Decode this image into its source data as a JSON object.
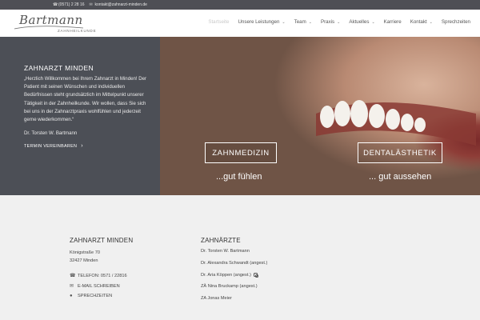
{
  "topbar": {
    "phone": "(0571) 2 28 16",
    "email": "kontakt@zahnarzt-minden.de",
    "phone_icon": "phone-icon",
    "email_icon": "envelope-icon"
  },
  "header": {
    "logo_script": "Bartmann",
    "logo_sub": "ZAHNHEILKUNDE",
    "nav": [
      {
        "label": "Startseite",
        "active": true,
        "dropdown": false
      },
      {
        "label": "Unsere Leistungen",
        "active": false,
        "dropdown": true
      },
      {
        "label": "Team",
        "active": false,
        "dropdown": true
      },
      {
        "label": "Praxis",
        "active": false,
        "dropdown": true
      },
      {
        "label": "Aktuelles",
        "active": false,
        "dropdown": true
      },
      {
        "label": "Karriere",
        "active": false,
        "dropdown": false
      },
      {
        "label": "Kontakt",
        "active": false,
        "dropdown": true
      },
      {
        "label": "Sprechzeiten",
        "active": false,
        "dropdown": false
      }
    ]
  },
  "hero": {
    "title": "ZAHNARZT MINDEN",
    "paragraph": "„Herzlich Willkommen bei Ihrem Zahnarzt in Minden! Der Patient mit seinen Wünschen und individuellen Bedürfnissen steht grundsätzlich im Mittelpunkt unserer Tätigkeit in der Zahnheilkunde. Wir wollen, dass Sie sich bei uns in der Zahnarztpraxis wohlfühlen und jederzeit gerne wiederkommen.“",
    "signature": "Dr. Torsten W. Bartmann",
    "cta": "TERMIN VEREINBAREN",
    "button_left": "ZAHNMEDIZIN",
    "button_right": "DENTALÄSTHETIK",
    "tagline_left": "...gut fühlen",
    "tagline_right": "... gut aussehen"
  },
  "footer": {
    "col1": {
      "title": "ZAHNARZT MINDEN",
      "street": "Königstraße 70",
      "city": "32427 Minden",
      "phone": "TELEFON: 0571 / 22816",
      "email": "E-MAIL SCHREIBEN",
      "hours": "SPRECHZEITEN"
    },
    "col2": {
      "title": "ZAHNÄRZTE",
      "doctors": [
        "Dr. Torsten W. Bartmann",
        "Dr. Alexandra Schwandt (angest.)",
        "Dr. Aria Köppen (angest.)",
        "ZÄ Nina Bruckamp (angest.)",
        "ZA Jonas Meier"
      ]
    }
  }
}
